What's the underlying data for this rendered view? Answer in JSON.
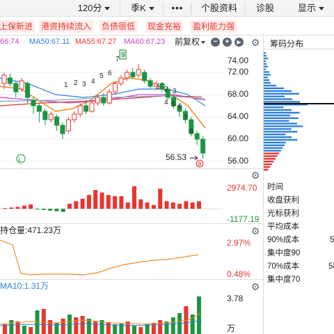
{
  "topbar": {
    "items": [
      "120分",
      "季K",
      "•••",
      "个股资料",
      "诊股",
      "显示"
    ]
  },
  "tags": [
    "上保新进",
    "港资持续流入",
    "负债很低",
    "现金充裕",
    "盈利能力强"
  ],
  "ma_row": {
    "ma_first": "66.74",
    "ma50": "MA50:67.11",
    "ma55": "MA55:67.27",
    "ma60": "MA60:67.23"
  },
  "adjust_mode": "前复权",
  "price_axis": [
    "74.00",
    "72.00",
    "68.00",
    "64.00",
    "60.00",
    "56.00"
  ],
  "annotations": {
    "low_price": "56.53",
    "num_labels": [
      "1",
      "2",
      "3",
      "4",
      "5",
      "6",
      "7",
      "8",
      "9",
      "1",
      "2",
      "3",
      "4",
      "5",
      "6",
      "7",
      "8",
      "9"
    ]
  },
  "macd": {
    "top": "2974.70",
    "bottom": "-1177.19"
  },
  "holding": {
    "title": "持仓量:471.23万",
    "top": "2.97%",
    "bottom": "0.48%"
  },
  "volume": {
    "title": "MA10:1.31万",
    "top": "3.78",
    "unit": "万"
  },
  "chips": {
    "title": "筹码分布",
    "info_labels": [
      "时间",
      "收盘获利",
      "光标获利",
      "平均成本",
      "90%成本",
      "集中度90",
      "70%成本",
      "集中度70"
    ],
    "info_values": [
      "",
      "",
      "",
      "",
      "5",
      "",
      "58",
      ""
    ]
  },
  "colors": {
    "up": "#e8362f",
    "down": "#1a9641",
    "ma_orange": "#f08c28",
    "ma_blue": "#2f7fd8",
    "ma_purple": "#c447c9"
  }
}
